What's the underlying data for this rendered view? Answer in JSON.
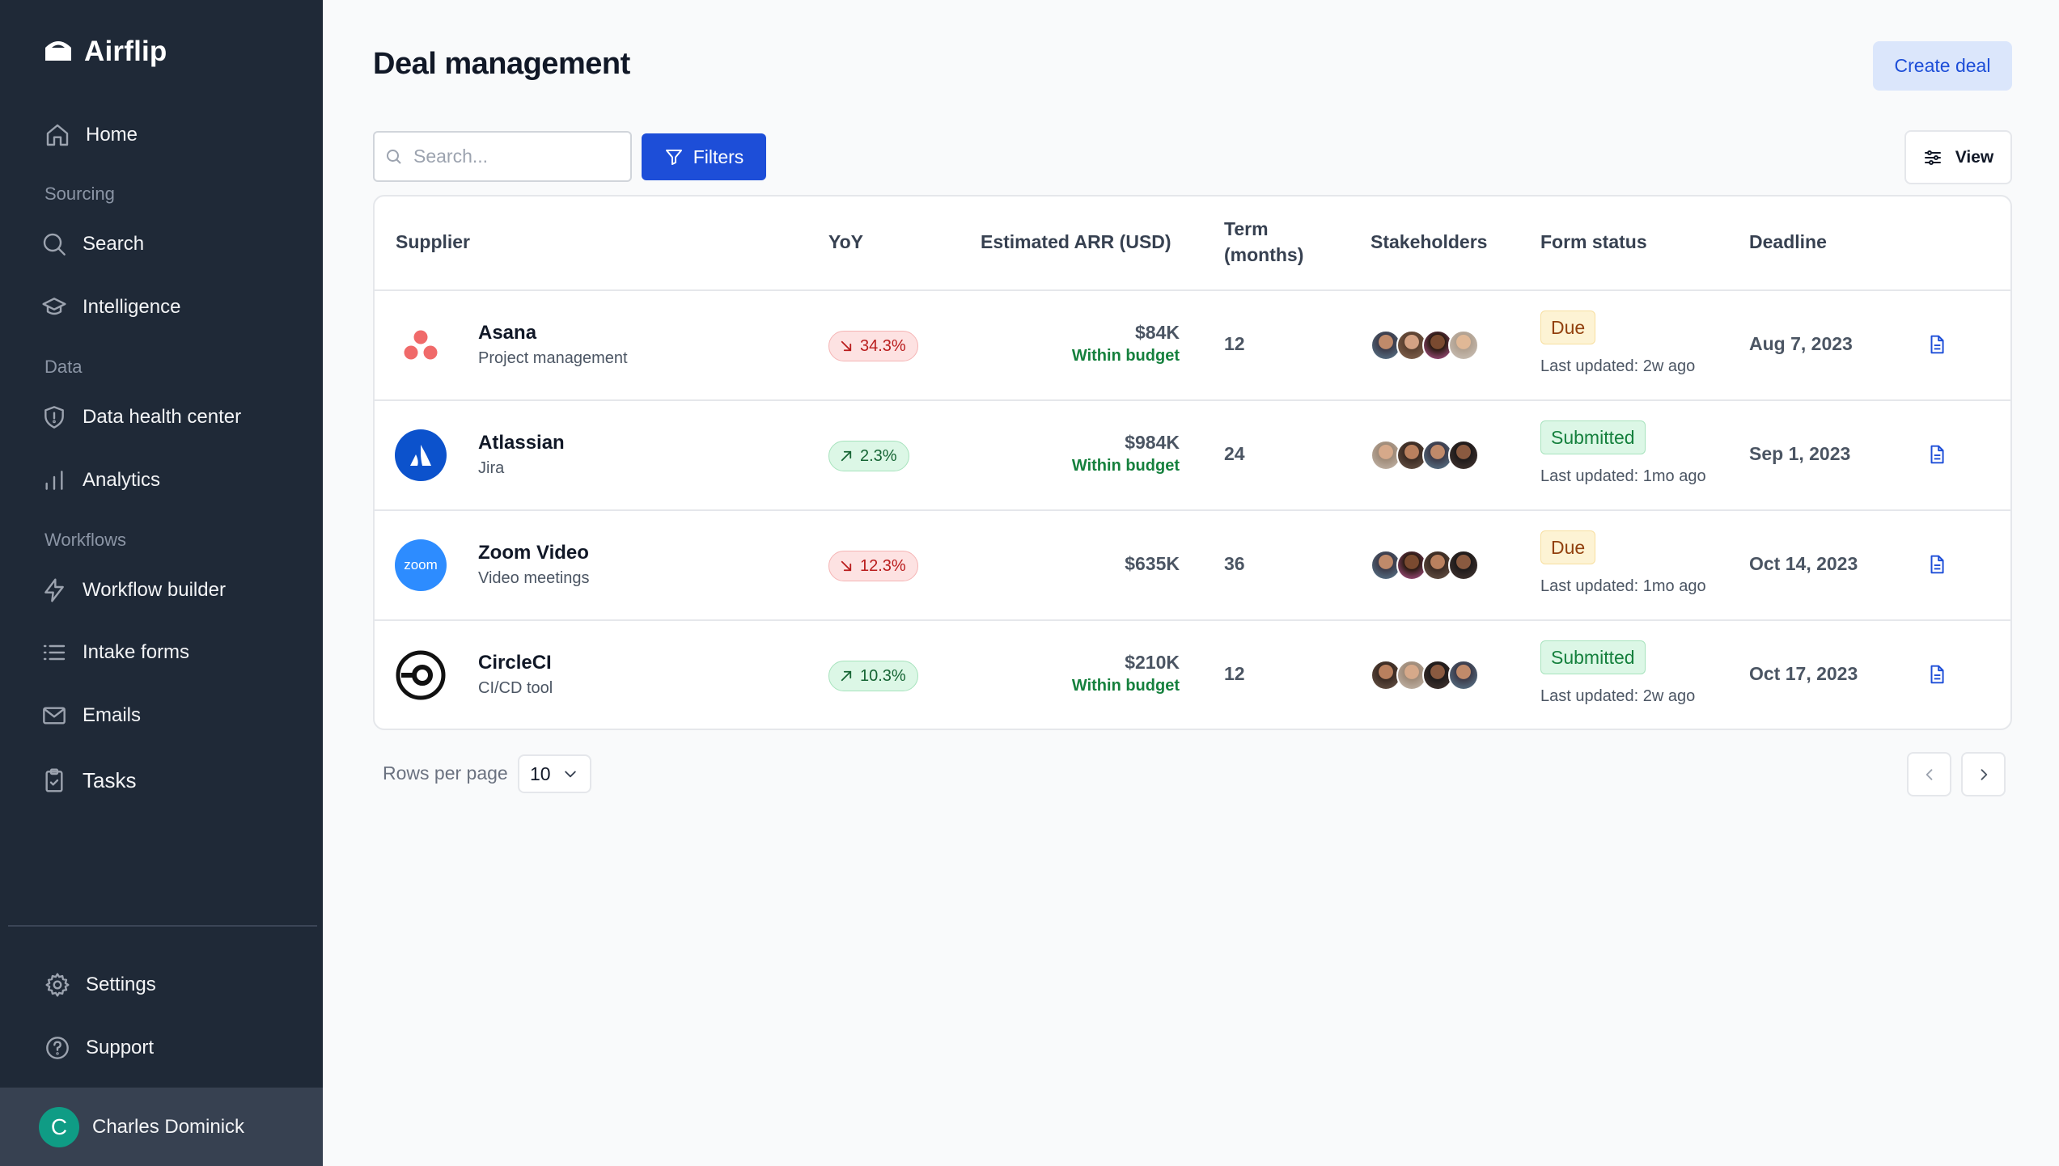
{
  "app": {
    "name": "Airflip"
  },
  "sidebar": {
    "items": [
      {
        "label": "Home",
        "icon": "home-icon"
      },
      {
        "section": "Sourcing"
      },
      {
        "label": "Search",
        "icon": "search-icon"
      },
      {
        "label": "Intelligence",
        "icon": "graduation-cap-icon"
      },
      {
        "section": "Data"
      },
      {
        "label": "Data health center",
        "icon": "shield-icon"
      },
      {
        "label": "Analytics",
        "icon": "bar-chart-icon"
      },
      {
        "section": "Workflows"
      },
      {
        "label": "Workflow builder",
        "icon": "lightning-icon"
      },
      {
        "label": "Intake forms",
        "icon": "list-icon"
      },
      {
        "label": "Emails",
        "icon": "mail-icon"
      },
      {
        "label": "Tasks",
        "icon": "clipboard-icon"
      }
    ],
    "bottom": [
      {
        "label": "Settings",
        "icon": "gear-icon"
      },
      {
        "label": "Support",
        "icon": "help-circle-icon"
      }
    ],
    "user": {
      "initial": "C",
      "name": "Charles Dominick"
    }
  },
  "header": {
    "title": "Deal management",
    "create_label": "Create deal"
  },
  "toolbar": {
    "search_placeholder": "Search...",
    "filters_label": "Filters",
    "view_label": "View"
  },
  "table": {
    "columns": [
      "Supplier",
      "YoY",
      "Estimated ARR (USD)",
      "Term\n(months)",
      "Stakeholders",
      "Form status",
      "Deadline"
    ],
    "term_header_1": "Term",
    "term_header_2": "(months)",
    "rows": [
      {
        "supplier": "Asana",
        "category": "Project management",
        "logo": "asana",
        "yoy": "34.3%",
        "yoy_dir": "down",
        "arr": "$84K",
        "arr_note": "Within budget",
        "term": "12",
        "status": "Due",
        "updated": "Last updated: 2w ago",
        "deadline": "Aug 7, 2023"
      },
      {
        "supplier": "Atlassian",
        "category": "Jira",
        "logo": "atlassian",
        "yoy": "2.3%",
        "yoy_dir": "up",
        "arr": "$984K",
        "arr_note": "Within budget",
        "term": "24",
        "status": "Submitted",
        "updated": "Last updated: 1mo ago",
        "deadline": "Sep 1, 2023"
      },
      {
        "supplier": "Zoom Video",
        "category": "Video meetings",
        "logo": "zoom",
        "logo_text": "zoom",
        "yoy": "12.3%",
        "yoy_dir": "down",
        "arr": "$635K",
        "arr_note": "",
        "term": "36",
        "status": "Due",
        "updated": "Last updated: 1mo ago",
        "deadline": "Oct 14, 2023"
      },
      {
        "supplier": "CircleCI",
        "category": "CI/CD tool",
        "logo": "circleci",
        "yoy": "10.3%",
        "yoy_dir": "up",
        "arr": "$210K",
        "arr_note": "Within budget",
        "term": "12",
        "status": "Submitted",
        "updated": "Last updated: 2w ago",
        "deadline": "Oct 17, 2023"
      }
    ]
  },
  "pagination": {
    "rows_label": "Rows per page",
    "rows_value": "10"
  },
  "colors": {
    "sidebar_bg": "#1f2937",
    "primary": "#1d4ed8",
    "due": "#92400e",
    "submitted": "#15803d",
    "negative": "#b91c1c"
  }
}
